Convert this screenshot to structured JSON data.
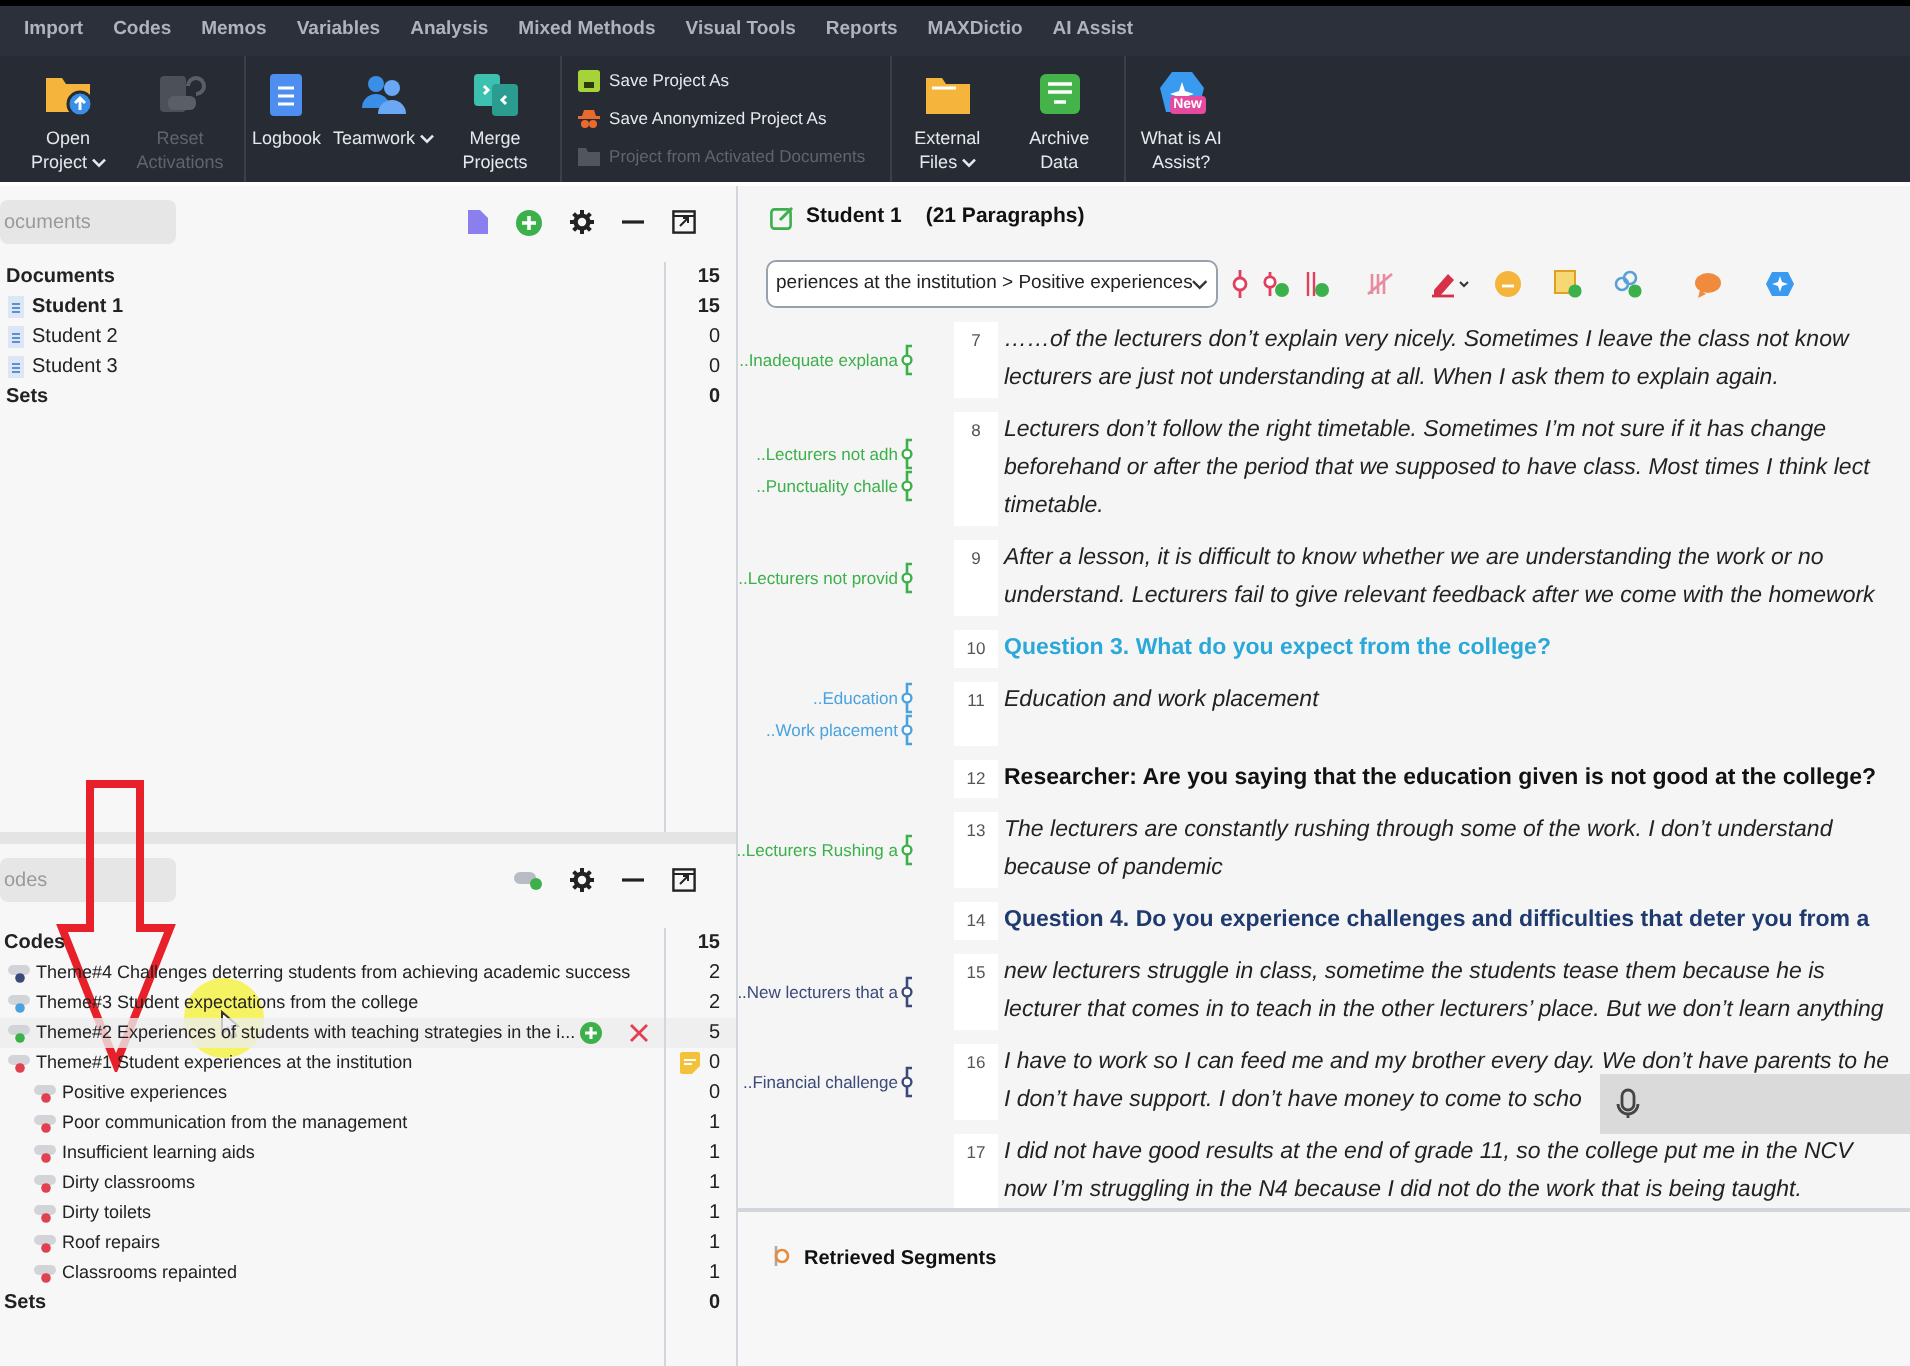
{
  "menu_tabs": [
    "Import",
    "Codes",
    "Memos",
    "Variables",
    "Analysis",
    "Mixed Methods",
    "Visual Tools",
    "Reports",
    "MAXDictio",
    "AI Assist"
  ],
  "ribbon": [
    {
      "kind": "large",
      "label": "Open Project",
      "dropdown": true,
      "disabled": false
    },
    {
      "kind": "large",
      "label": "Reset Activations",
      "dropdown": false,
      "disabled": true
    },
    {
      "kind": "large",
      "label": "Logbook",
      "dropdown": false,
      "disabled": false
    },
    {
      "kind": "large",
      "label": "Teamwork",
      "dropdown": true,
      "disabled": false
    },
    {
      "kind": "large",
      "label": "Merge Projects",
      "dropdown": false,
      "disabled": false
    },
    {
      "kind": "stack",
      "items": [
        {
          "label": "Save Project As",
          "disabled": false
        },
        {
          "label": "Save Anonymized Project As",
          "disabled": false
        },
        {
          "label": "Project from Activated Documents",
          "disabled": true
        }
      ]
    },
    {
      "kind": "large",
      "label": "External Files",
      "dropdown": true,
      "disabled": false
    },
    {
      "kind": "large",
      "label": "Archive Data",
      "dropdown": false,
      "disabled": false
    },
    {
      "kind": "large",
      "label": "What is AI Assist?",
      "dropdown": false,
      "disabled": false,
      "badge": "New"
    }
  ],
  "documents": {
    "search": {
      "placeholder": "ocuments"
    },
    "root": {
      "label": "Documents",
      "count": "15"
    },
    "items": [
      {
        "label": "Student 1",
        "count": "15",
        "opened": true
      },
      {
        "label": "Student 2",
        "count": "0",
        "opened": false
      },
      {
        "label": "Student 3",
        "count": "0",
        "opened": false
      }
    ],
    "sets": {
      "label": "Sets",
      "count": "0"
    }
  },
  "codes": {
    "search": {
      "placeholder": "odes"
    },
    "root": {
      "label": "Codes",
      "count": "15"
    },
    "items": [
      {
        "label": "Theme#4 Challenges deterring students from achieving academic success",
        "count": "2",
        "color": "#3b4a7a",
        "hovered": false,
        "memo": false
      },
      {
        "label": "Theme#3 Student expectations from the college",
        "count": "2",
        "color": "#4aa3df",
        "hovered": false,
        "memo": false
      },
      {
        "label": "Theme#2 Experiences of students with teaching strategies in the i...",
        "count": "5",
        "color": "#3cb04a",
        "hovered": true,
        "memo": false
      },
      {
        "label": "Theme#1 Student experiences at the institution",
        "count": "0",
        "color": "#e0404f",
        "hovered": false,
        "memo": true,
        "children": [
          {
            "label": "Positive experiences",
            "count": "0",
            "color": "#e0404f"
          },
          {
            "label": "Poor communication from the management",
            "count": "1",
            "color": "#e0404f"
          },
          {
            "label": "Insufficient learning aids",
            "count": "1",
            "color": "#e0404f"
          },
          {
            "label": "Dirty classrooms",
            "count": "1",
            "color": "#e0404f"
          },
          {
            "label": "Dirty toilets",
            "count": "1",
            "color": "#e0404f"
          },
          {
            "label": "Roof repairs",
            "count": "1",
            "color": "#e0404f"
          },
          {
            "label": "Classrooms repainted",
            "count": "1",
            "color": "#e0404f"
          }
        ]
      }
    ],
    "sets": {
      "label": "Sets",
      "count": "0"
    }
  },
  "document": {
    "title": "Student 1",
    "paragraph_count": "(21 Paragraphs)",
    "code_selector": "periences at the institution > Positive experiences",
    "paragraphs": [
      {
        "number": "7",
        "kind": "answer",
        "lines": [
          "……of the lecturers don’t explain very nicely. Sometimes I leave the class not know",
          "lecturers are just not understanding at all. When I ask them to explain again."
        ],
        "codes": [
          {
            "label": "..Inadequate explana",
            "color": "#3cb04a"
          }
        ]
      },
      {
        "number": "8",
        "kind": "answer",
        "lines": [
          "Lecturers don’t follow the right timetable. Sometimes I’m not sure if it has change",
          "beforehand or after the period that we supposed to have class. Most times I think lect",
          "timetable."
        ],
        "codes": [
          {
            "label": "..Lecturers not adh",
            "color": "#3cb04a"
          },
          {
            "label": "..Punctuality challe",
            "color": "#3cb04a"
          }
        ]
      },
      {
        "number": "9",
        "kind": "answer",
        "lines": [
          "After a lesson, it is difficult to know whether we are understanding the work or no",
          "understand. Lecturers fail to give relevant feedback after we come with the homework"
        ],
        "codes": [
          {
            "label": "..Lecturers not provid",
            "color": "#3cb04a"
          }
        ]
      },
      {
        "number": "10",
        "kind": "question",
        "color": "#2aa8d8",
        "lines": [
          "Question 3. What do you expect from the college?"
        ]
      },
      {
        "number": "11",
        "kind": "answer",
        "lines": [
          "Education and work placement"
        ],
        "codes": [
          {
            "label": "..Education",
            "color": "#4aa3df"
          },
          {
            "label": "..Work placement",
            "color": "#4aa3df"
          }
        ]
      },
      {
        "number": "12",
        "kind": "researcher",
        "lines": [
          "Researcher: Are you saying that the education given is not good at the college?"
        ]
      },
      {
        "number": "13",
        "kind": "answer",
        "lines": [
          "The lecturers are constantly rushing through some of the work. I don’t understand",
          "because of pandemic"
        ],
        "codes": [
          {
            "label": "..Lecturers Rushing a",
            "color": "#3cb04a"
          }
        ]
      },
      {
        "number": "14",
        "kind": "question",
        "color": "#1e3a6e",
        "lines": [
          "Question 4. Do you experience challenges and difficulties that deter you from a"
        ]
      },
      {
        "number": "15",
        "kind": "answer",
        "lines": [
          "new lecturers struggle in class, sometime the students tease them because he is",
          "lecturer that comes in to teach in the other lecturers’ place. But we don’t learn anything"
        ],
        "codes": [
          {
            "label": "..New lecturers that a",
            "color": "#3b4a7a"
          }
        ]
      },
      {
        "number": "16",
        "kind": "answer",
        "lines": [
          "I have to work so I can feed me and my brother every day. We don’t have parents to he",
          "I don’t have support. I don’t have money to come to scho"
        ],
        "codes": [
          {
            "label": "..Financial challenge",
            "color": "#3b4a7a"
          }
        ]
      },
      {
        "number": "17",
        "kind": "answer",
        "lines": [
          "I did not have good results at the end of grade 11, so the college put me in the NCV",
          "now I’m struggling in the N4 because I did not do the work that is being taught."
        ]
      }
    ]
  },
  "retrieved": {
    "title": "Retrieved Segments"
  }
}
